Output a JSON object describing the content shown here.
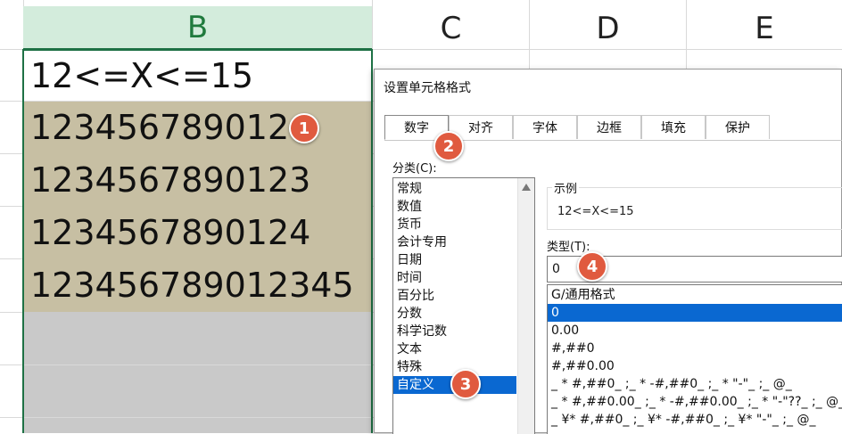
{
  "sheet": {
    "columns": [
      "B",
      "C",
      "D",
      "E"
    ],
    "header_cell": "12<=X<=15",
    "rows": [
      "123456789012",
      "1234567890123",
      "1234567890124",
      "123456789012345"
    ]
  },
  "badges": [
    "1",
    "2",
    "3",
    "4"
  ],
  "dialog": {
    "title": "设置单元格格式",
    "tabs": [
      "数字",
      "对齐",
      "字体",
      "边框",
      "填充",
      "保护"
    ],
    "category_label": "分类(C):",
    "categories": [
      "常规",
      "数值",
      "货币",
      "会计专用",
      "日期",
      "时间",
      "百分比",
      "分数",
      "科学记数",
      "文本",
      "特殊",
      "自定义"
    ],
    "sample_label": "示例",
    "sample_value": "12<=X<=15",
    "type_label": "类型(T):",
    "type_value": "0",
    "type_list": [
      "G/通用格式",
      "0",
      "0.00",
      "#,##0",
      "#,##0.00",
      "_ * #,##0_ ;_ * -#,##0_ ;_ * \"-\"_ ;_ @_",
      "_ * #,##0.00_ ;_ * -#,##0.00_ ;_ * \"-\"??_ ;_ @_",
      "_ ¥* #,##0_ ;_ ¥* -#,##0_ ;_ ¥* \"-\"_ ;_ @_"
    ]
  },
  "colors": {
    "accent": "#0a68d1",
    "highlight": "#c7bfa3",
    "badge": "#e05a3f",
    "header_selected": "#d3ecdc"
  }
}
